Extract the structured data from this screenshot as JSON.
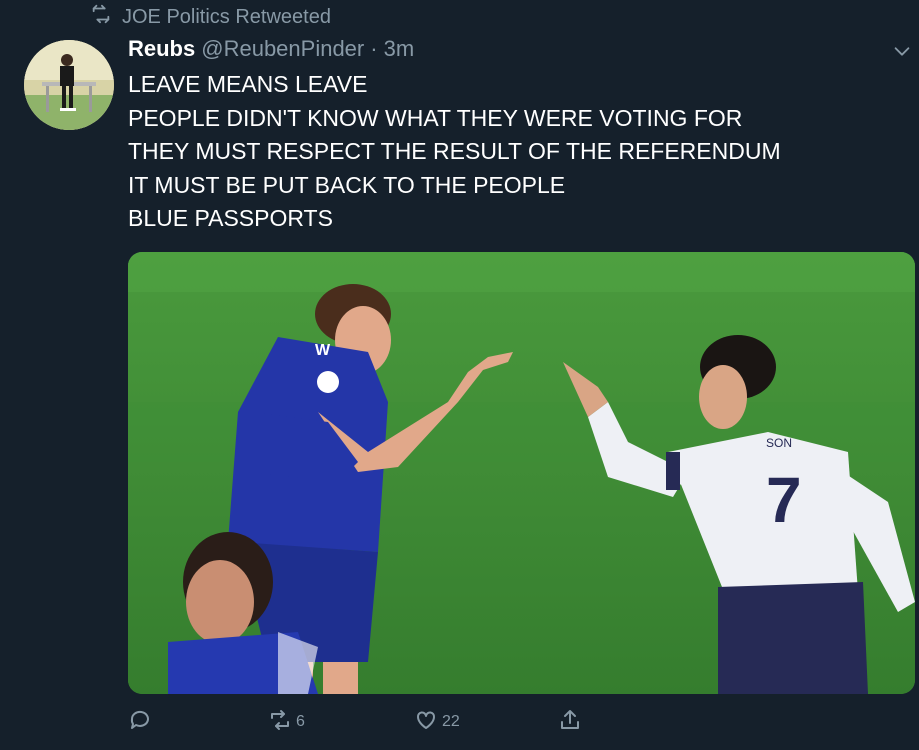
{
  "retweet": {
    "label": "JOE Politics Retweeted"
  },
  "tweet": {
    "display_name": "Reubs",
    "handle": "@ReubenPinder",
    "separator": "·",
    "time": "3m",
    "lines": [
      "LEAVE MEANS LEAVE",
      "PEOPLE DIDN'T KNOW WHAT THEY WERE VOTING FOR",
      "THEY MUST RESPECT THE RESULT OF THE REFERENDUM",
      "IT MUST BE PUT BACK TO THE PEOPLE",
      "BLUE PASSPORTS"
    ],
    "media": {
      "left_shirt_badge": "W",
      "right_shirt_name": "SON",
      "right_shirt_number": "7"
    }
  },
  "actions": {
    "reply_count": "",
    "retweet_count": "6",
    "like_count": "22"
  },
  "colors": {
    "background": "#15202b",
    "secondary_text": "#8899a6",
    "pitch_green": "#3e8a35",
    "blue_kit": "#2436a8"
  },
  "icons": [
    "retweet-icon",
    "chevron-down-icon",
    "reply-icon",
    "retweet-icon",
    "like-icon",
    "share-icon"
  ]
}
